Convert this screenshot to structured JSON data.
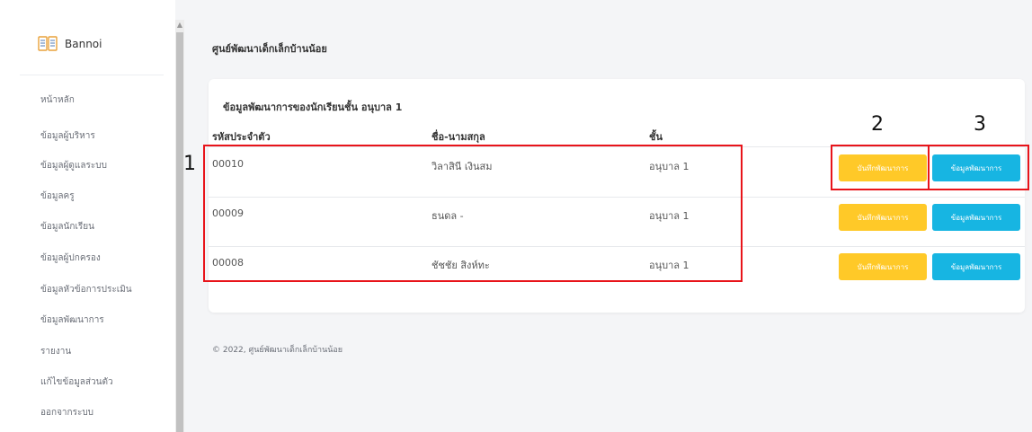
{
  "sidebar": {
    "brand": "Bannoi",
    "items": [
      {
        "label": "หน้าหลัก"
      },
      {
        "label": "ข้อมูลผู้บริหาร"
      },
      {
        "label": "ข้อมูลผู้ดูแลระบบ"
      },
      {
        "label": "ข้อมูลครู"
      },
      {
        "label": "ข้อมูลนักเรียน"
      },
      {
        "label": "ข้อมูลผู้ปกครอง"
      },
      {
        "label": "ข้อมูลหัวข้อการประเมิน"
      },
      {
        "label": "ข้อมูลพัฒนาการ"
      },
      {
        "label": "รายงาน"
      },
      {
        "label": "แก้ไขข้อมูลส่วนตัว"
      },
      {
        "label": "ออกจากระบบ"
      }
    ]
  },
  "header": {
    "title": "ศูนย์พัฒนาเด็กเล็กบ้านน้อย"
  },
  "card": {
    "title": "ข้อมูลพัฒนาการของนักเรียนชั้น อนุบาล 1",
    "columns": [
      "รหัสประจำตัว",
      "ชื่อ-นามสกุล",
      "ชั้น"
    ],
    "rows": [
      {
        "id": "00010",
        "name": "วิลาสินี เงินสม",
        "class": "อนุบาล 1"
      },
      {
        "id": "00009",
        "name": "ธนดล -",
        "class": "อนุบาล 1"
      },
      {
        "id": "00008",
        "name": "ชัชชัย สิงห์ทะ",
        "class": "อนุบาล 1"
      }
    ],
    "btn_record": "บันทึกพัฒนาการ",
    "btn_info": "ข้อมูลพัฒนาการ"
  },
  "footer": "© 2022, ศูนย์พัฒนาเด็กเล็กบ้านน้อย",
  "annotations": [
    "1",
    "2",
    "3"
  ],
  "colors": {
    "record_button": "#ffc928",
    "info_button": "#17b5e2",
    "annotation": "#e8141a"
  }
}
